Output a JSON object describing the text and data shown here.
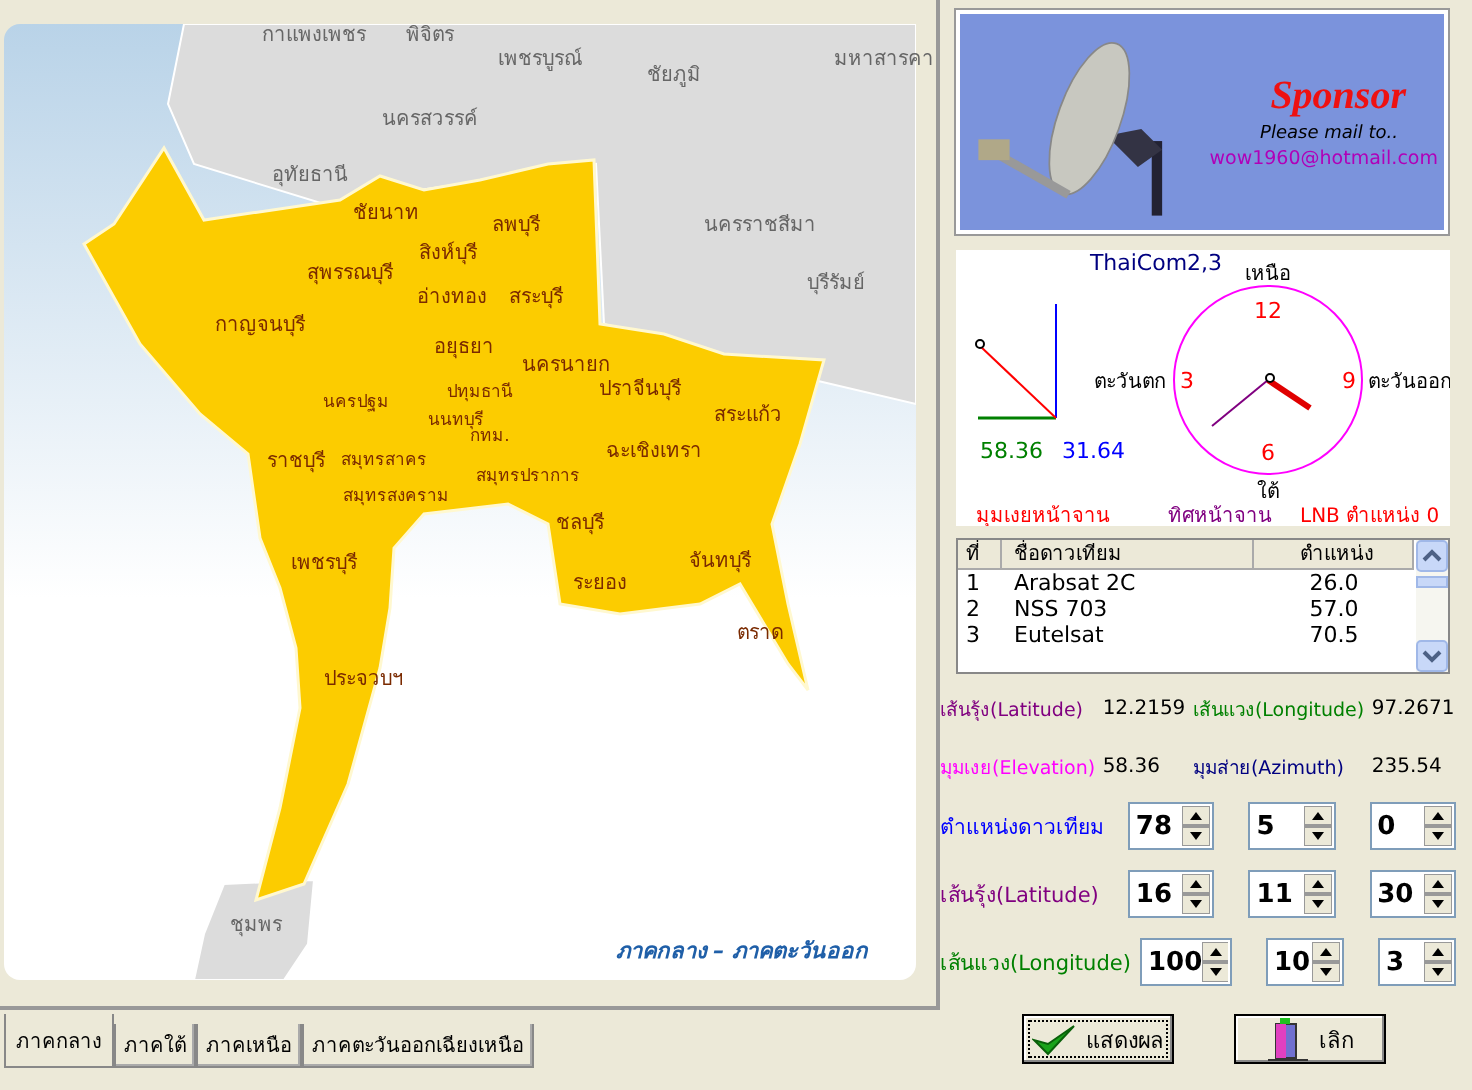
{
  "map": {
    "labels": [
      {
        "text": "กาแพงเพชร",
        "kind": "other"
      },
      {
        "text": "พิจิตร",
        "kind": "other"
      },
      {
        "text": "เพชรบูรณ์",
        "kind": "other"
      },
      {
        "text": "ชัยภูมิ",
        "kind": "other"
      },
      {
        "text": "มหาสารคา",
        "kind": "other"
      },
      {
        "text": "นครสวรรค์",
        "kind": "other"
      },
      {
        "text": "อุทัยธานี",
        "kind": "other"
      },
      {
        "text": "นครราชสีมา",
        "kind": "other"
      },
      {
        "text": "บุรีรัมย์",
        "kind": "other"
      },
      {
        "text": "ชัยนาท",
        "kind": "highlighted"
      },
      {
        "text": "ลพบุรี",
        "kind": "highlighted"
      },
      {
        "text": "สิงห์บุรี",
        "kind": "highlighted"
      },
      {
        "text": "สุพรรณบุรี",
        "kind": "highlighted"
      },
      {
        "text": "อ่างทอง",
        "kind": "highlighted"
      },
      {
        "text": "สระบุรี",
        "kind": "highlighted"
      },
      {
        "text": "กาญจนบุรี",
        "kind": "highlighted"
      },
      {
        "text": "อยุธยา",
        "kind": "highlighted"
      },
      {
        "text": "นครนายก",
        "kind": "highlighted"
      },
      {
        "text": "ปทุมธานี",
        "kind": "highlighted"
      },
      {
        "text": "ปราจีนบุรี",
        "kind": "highlighted"
      },
      {
        "text": "นครปฐม",
        "kind": "highlighted"
      },
      {
        "text": "นนทบุรี",
        "kind": "highlighted"
      },
      {
        "text": "สระแก้ว",
        "kind": "highlighted"
      },
      {
        "text": "กทม.",
        "kind": "highlighted"
      },
      {
        "text": "ฉะเชิงเทรา",
        "kind": "highlighted"
      },
      {
        "text": "ราชบุรี",
        "kind": "highlighted"
      },
      {
        "text": "สมุทรสาคร",
        "kind": "highlighted"
      },
      {
        "text": "สมุทรปราการ",
        "kind": "highlighted"
      },
      {
        "text": "สมุทรสงคราม",
        "kind": "highlighted"
      },
      {
        "text": "ชลบุรี",
        "kind": "highlighted"
      },
      {
        "text": "เพชรบุรี",
        "kind": "highlighted"
      },
      {
        "text": "จันทบุรี",
        "kind": "highlighted"
      },
      {
        "text": "ระยอง",
        "kind": "highlighted"
      },
      {
        "text": "ประจวบฯ",
        "kind": "highlighted"
      },
      {
        "text": "ตราด",
        "kind": "highlighted"
      },
      {
        "text": "ชุมพร",
        "kind": "other"
      }
    ],
    "caption": "ภาคกลาง – ภาคตะวันออก"
  },
  "tabs": [
    {
      "label": "ภาคกลาง",
      "selected": true
    },
    {
      "label": "ภาคใต้",
      "selected": false
    },
    {
      "label": "ภาคเหนือ",
      "selected": false
    },
    {
      "label": "ภาคตะวันออกเฉียงเหนือ",
      "selected": false
    }
  ],
  "sponsor": {
    "title": "Sponsor",
    "note": "Please mail to..",
    "email": "wow1960@hotmail.com"
  },
  "compass": {
    "satellite": "ThaiCom2,3",
    "north": "เหนือ",
    "twelve": "12",
    "west": "ตะวันตก",
    "three": "3",
    "nine": "9",
    "east": "ตะวันออก",
    "six": "6",
    "south": "ใต้",
    "elevation_value": "58.36",
    "complement_value": "31.64",
    "elevation_caption": "มุมเงยหน้าจาน",
    "direction_caption": "ทิศหน้าจาน",
    "lnb_caption": "LNB ตำแหน่ง 0"
  },
  "satellite_list": {
    "columns": [
      "ที่",
      "ชื่อดาวเทียม",
      "ตำแหน่ง"
    ],
    "rows": [
      [
        "1",
        "Arabsat 2C",
        "26.0"
      ],
      [
        "2",
        "NSS 703",
        "57.0"
      ],
      [
        "3",
        "Eutelsat",
        "70.5"
      ]
    ]
  },
  "results": [
    {
      "label": "เส้นรุ้ง(Latitude)",
      "value": "12.2159",
      "color": "#800080"
    },
    {
      "label": "เส้นแวง(Longitude)",
      "value": "97.2671",
      "color": "#008000"
    },
    {
      "label": "มุมเงย(Elevation)",
      "value": "58.36",
      "color": "#ff00ff"
    },
    {
      "label": "มุมส่าย(Azimuth)",
      "value": "235.54",
      "color": "#000080"
    }
  ],
  "inputs": [
    {
      "label": "ตำแหน่งดาวเทียม",
      "color": "#0000ff",
      "values": [
        "78",
        "5",
        "0"
      ]
    },
    {
      "label": "เส้นรุ้ง(Latitude)",
      "color": "#800080",
      "values": [
        "16",
        "11",
        "30"
      ]
    },
    {
      "label": "เส้นแวง(Longitude)",
      "color": "#008000",
      "values": [
        "100",
        "10",
        "3"
      ]
    }
  ],
  "buttons": [
    {
      "label": "แสดงผล",
      "kind": "ok"
    },
    {
      "label": "เลิก",
      "kind": "exit"
    }
  ]
}
